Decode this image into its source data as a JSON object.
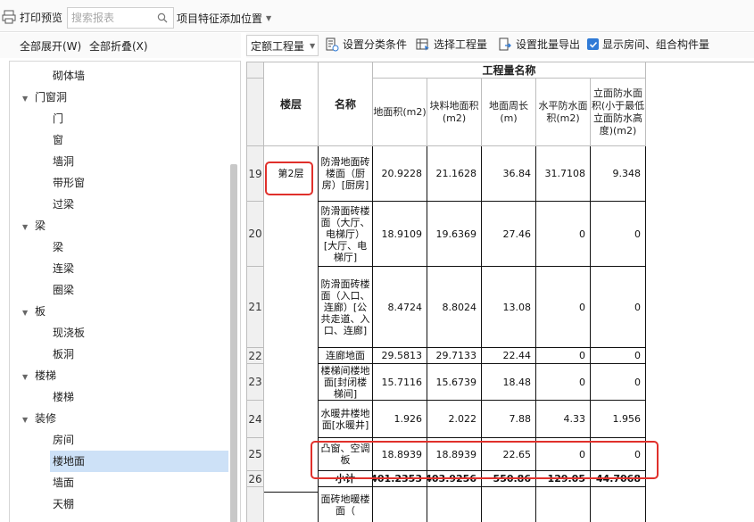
{
  "toolbar": {
    "print_preview": "打印预览",
    "search_placeholder": "搜索报表",
    "feature_position": "项目特征添加位置"
  },
  "left_toolbar": {
    "expand_all": "全部展开(W)",
    "collapse_all": "全部折叠(X)"
  },
  "tree": [
    {
      "label": "砌体墙",
      "level": 2
    },
    {
      "label": "门窗洞",
      "level": 1
    },
    {
      "label": "门",
      "level": 2
    },
    {
      "label": "窗",
      "level": 2
    },
    {
      "label": "墙洞",
      "level": 2
    },
    {
      "label": "带形窗",
      "level": 2
    },
    {
      "label": "过梁",
      "level": 2
    },
    {
      "label": "梁",
      "level": 1
    },
    {
      "label": "梁",
      "level": 2
    },
    {
      "label": "连梁",
      "level": 2
    },
    {
      "label": "圈梁",
      "level": 2
    },
    {
      "label": "板",
      "level": 1
    },
    {
      "label": "现浇板",
      "level": 2
    },
    {
      "label": "板洞",
      "level": 2
    },
    {
      "label": "楼梯",
      "level": 1
    },
    {
      "label": "楼梯",
      "level": 2
    },
    {
      "label": "装修",
      "level": 1
    },
    {
      "label": "房间",
      "level": 2
    },
    {
      "label": "楼地面",
      "level": 2,
      "selected": true
    },
    {
      "label": "墙面",
      "level": 2
    },
    {
      "label": "天棚",
      "level": 2
    }
  ],
  "right_toolbar": {
    "mode_select": "定额工程量",
    "set_category": "设置分类条件",
    "select_quantity": "选择工程量",
    "batch_export": "设置批量导出",
    "show_rooms": "显示房间、组合构件量",
    "show_rooms_checked": true
  },
  "table": {
    "group_header": "工程量名称",
    "col_floor": "楼层",
    "col_name": "名称",
    "columns": [
      "地面积(m2)",
      "块料地面积(m2)",
      "地面周长(m)",
      "水平防水面积(m2)",
      "立面防水面积(小于最低立面防水高度)(m2)"
    ],
    "floor_label": "第2层",
    "rows": [
      {
        "num": "19",
        "name": "防滑地面砖楼面（厨房）[厨房]",
        "values": [
          "20.9228",
          "21.1628",
          "36.84",
          "31.7108",
          "9.348"
        ]
      },
      {
        "num": "20",
        "name": "防滑面砖楼面（大厅、电梯厅）[大厅、电梯厅]",
        "values": [
          "18.9109",
          "19.6369",
          "27.46",
          "0",
          "0"
        ]
      },
      {
        "num": "21",
        "name": "防滑面砖楼面（入口、连廊）[公共走道、入口、连廊]",
        "values": [
          "8.4724",
          "8.8024",
          "13.08",
          "0",
          "0"
        ]
      },
      {
        "num": "22",
        "name": "连廊地面",
        "values": [
          "29.5813",
          "29.7133",
          "22.44",
          "0",
          "0"
        ]
      },
      {
        "num": "23",
        "name": "楼梯间楼地面[封闭楼梯间]",
        "values": [
          "15.7116",
          "15.6739",
          "18.48",
          "0",
          "0"
        ]
      },
      {
        "num": "24",
        "name": "水暖井楼地面[水暖井]",
        "values": [
          "1.926",
          "2.022",
          "7.88",
          "4.33",
          "1.956"
        ]
      },
      {
        "num": "25",
        "name": "凸窗、空调板",
        "values": [
          "18.8939",
          "18.8939",
          "22.65",
          "0",
          "0"
        ]
      },
      {
        "num": "26",
        "name": "小计",
        "values": [
          "401.2353",
          "403.9256",
          "550.86",
          "129.05",
          "44.7068"
        ],
        "subtotal": true
      },
      {
        "num": "",
        "name": "面砖地暖楼面（",
        "values": [
          "",
          "",
          "",
          "",
          ""
        ]
      }
    ]
  }
}
